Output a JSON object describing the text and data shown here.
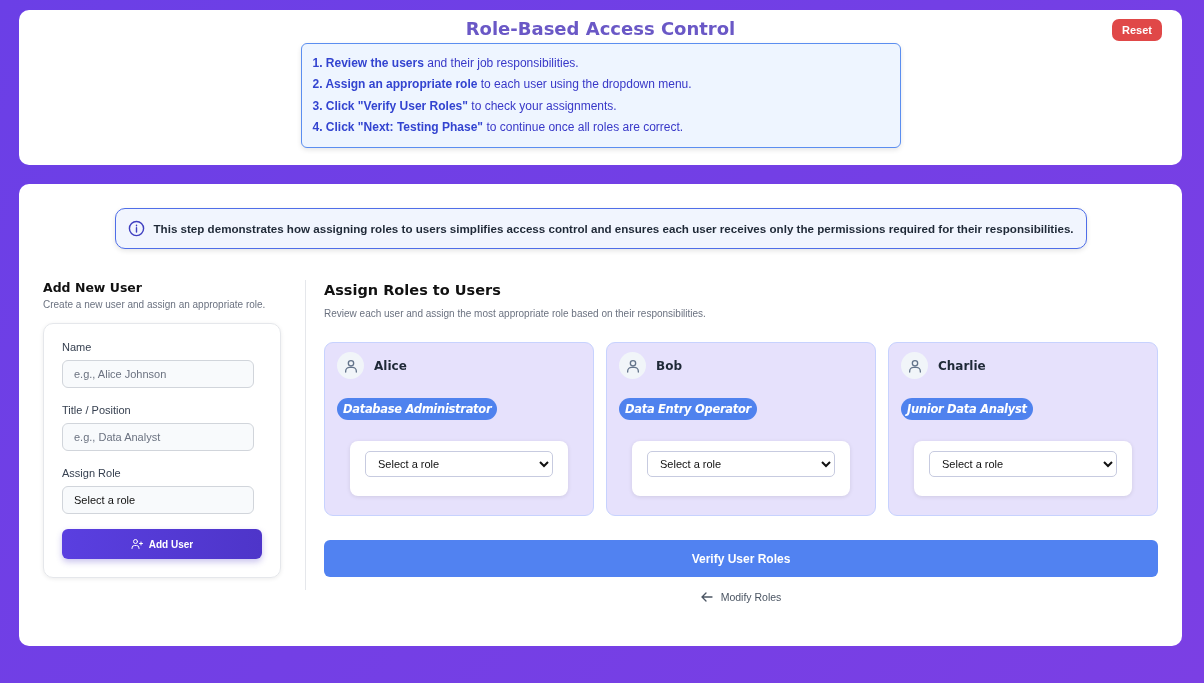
{
  "header": {
    "title": "Role-Based Access Control",
    "reset_button": "Reset",
    "instructions": [
      "**1. Review the users** and their job responsibilities.",
      "**2. Assign an appropriate role** to each user using the dropdown menu.",
      "**3. Click \"Verify User Roles\"** to check your assignments.",
      "**4. Click \"Next: Testing Phase\"** to continue once all roles are correct."
    ]
  },
  "info_banner": {
    "text": "This step demonstrates how assigning roles to users simplifies access control and ensures each user receives only the permissions required for their responsibilities."
  },
  "add_user": {
    "title": "Add New User",
    "subtitle": "Create a new user and assign an appropriate role.",
    "fields": [
      {
        "kind": "text",
        "label": "Name",
        "placeholder": "e.g., Alice Johnson"
      },
      {
        "kind": "text",
        "label": "Title / Position",
        "placeholder": "e.g., Data Analyst"
      },
      {
        "kind": "select",
        "label": "Assign Role",
        "value": "Select a role"
      }
    ],
    "button": "Add User"
  },
  "assign": {
    "title": "Assign Roles to Users",
    "subtitle": "Review each user and assign the most appropriate role based on their responsibilities.",
    "users": [
      {
        "name": "Alice",
        "title": "Database Administrator",
        "role": "Select a role"
      },
      {
        "name": "Bob",
        "title": "Data Entry Operator",
        "role": "Select a role"
      },
      {
        "name": "Charlie",
        "title": "Junior Data Analyst",
        "role": "Select a role"
      }
    ],
    "verify_button": "Verify User Roles",
    "modify_link": "Modify Roles"
  }
}
